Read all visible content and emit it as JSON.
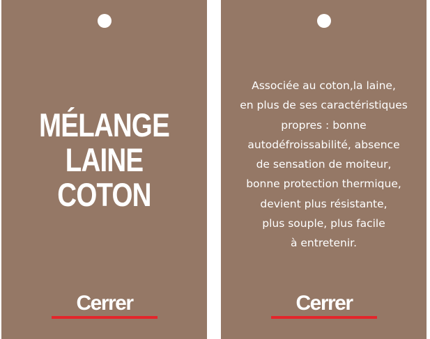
{
  "tags": {
    "front": {
      "title_line_1": "MÉLANGE",
      "title_line_2": "LAINE COTON",
      "brand": "Cerrer"
    },
    "back": {
      "description_lines": [
        "Associée au coton,la laine,",
        "en plus de ses caractéristiques",
        "propres : bonne",
        "autodéfroissabilité, absence",
        "de sensation de moiteur,",
        "bonne protection thermique,",
        "devient plus résistante,",
        "plus souple, plus facile",
        "à entretenir."
      ],
      "brand": "Cerrer"
    }
  },
  "colors": {
    "tag_background": "#957866",
    "text": "#ffffff",
    "brand_underline": "#e3262b"
  }
}
